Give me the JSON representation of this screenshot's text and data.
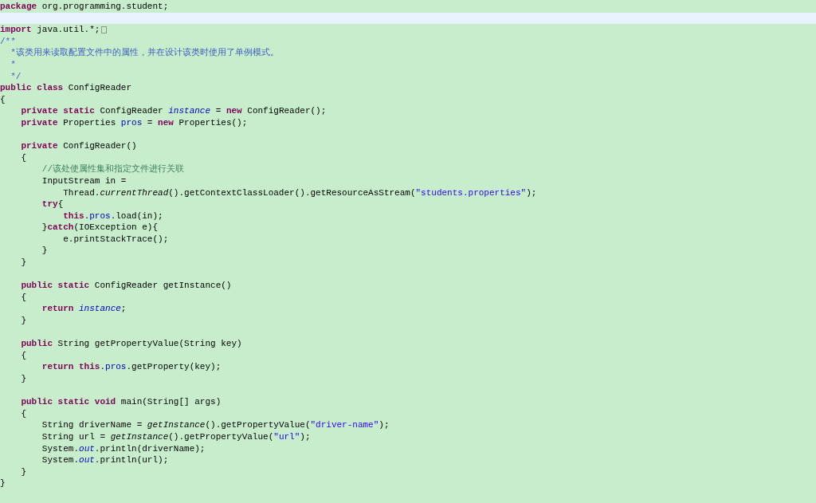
{
  "editor": {
    "lines": [
      {
        "tokens": [
          {
            "text": "package",
            "kind": "keyword"
          },
          {
            "text": " org.programming.student;",
            "kind": "plain"
          }
        ]
      },
      {
        "current": true
      },
      {
        "tokens": [
          {
            "text": "import",
            "kind": "keyword"
          },
          {
            "text": " java.util.*;",
            "kind": "plain"
          }
        ],
        "folded": true
      },
      {
        "tokens": [
          {
            "text": "/**",
            "kind": "javadoc"
          }
        ]
      },
      {
        "tokens": [
          {
            "text": "  *该类用来读取配置文件中的属性，并在设计该类时使用了单例模式。",
            "kind": "javadoc"
          }
        ]
      },
      {
        "tokens": [
          {
            "text": "  *",
            "kind": "javadoc"
          }
        ]
      },
      {
        "tokens": [
          {
            "text": "  */",
            "kind": "javadoc"
          }
        ]
      },
      {
        "tokens": [
          {
            "text": "public class",
            "kind": "keyword"
          },
          {
            "text": " ConfigReader",
            "kind": "plain"
          }
        ]
      },
      {
        "tokens": [
          {
            "text": "{",
            "kind": "plain"
          }
        ]
      },
      {
        "tokens": [
          {
            "text": "    private static",
            "kind": "keyword"
          },
          {
            "text": " ConfigReader ",
            "kind": "plain"
          },
          {
            "text": "instance",
            "kind": "static_field"
          },
          {
            "text": " = ",
            "kind": "plain"
          },
          {
            "text": "new",
            "kind": "keyword"
          },
          {
            "text": " ConfigReader();",
            "kind": "plain"
          }
        ]
      },
      {
        "tokens": [
          {
            "text": "    private",
            "kind": "keyword"
          },
          {
            "text": " Properties ",
            "kind": "plain"
          },
          {
            "text": "pros",
            "kind": "field"
          },
          {
            "text": " = ",
            "kind": "plain"
          },
          {
            "text": "new",
            "kind": "keyword"
          },
          {
            "text": " Properties();",
            "kind": "plain"
          }
        ]
      },
      {
        "current": false
      },
      {
        "tokens": [
          {
            "text": "    private",
            "kind": "keyword"
          },
          {
            "text": " ConfigReader()",
            "kind": "plain"
          }
        ]
      },
      {
        "tokens": [
          {
            "text": "    {",
            "kind": "plain"
          }
        ]
      },
      {
        "tokens": [
          {
            "text": "        //该处使属性集和指定文件进行关联",
            "kind": "comment"
          }
        ]
      },
      {
        "tokens": [
          {
            "text": "        InputStream in =",
            "kind": "plain"
          }
        ]
      },
      {
        "tokens": [
          {
            "text": "            Thread.",
            "kind": "plain"
          },
          {
            "text": "currentThread",
            "kind": "static_method"
          },
          {
            "text": "().getContextClassLoader().getResourceAsStream(",
            "kind": "plain"
          },
          {
            "text": "\"students.properties\"",
            "kind": "string"
          },
          {
            "text": ");",
            "kind": "plain"
          }
        ]
      },
      {
        "tokens": [
          {
            "text": "        try",
            "kind": "keyword"
          },
          {
            "text": "{",
            "kind": "plain"
          }
        ]
      },
      {
        "tokens": [
          {
            "text": "            this",
            "kind": "keyword"
          },
          {
            "text": ".",
            "kind": "plain"
          },
          {
            "text": "pros",
            "kind": "field"
          },
          {
            "text": ".load(in);",
            "kind": "plain"
          }
        ]
      },
      {
        "tokens": [
          {
            "text": "        }",
            "kind": "plain"
          },
          {
            "text": "catch",
            "kind": "keyword"
          },
          {
            "text": "(IOException e){",
            "kind": "plain"
          }
        ]
      },
      {
        "tokens": [
          {
            "text": "            e.printStackTrace();",
            "kind": "plain"
          }
        ]
      },
      {
        "tokens": [
          {
            "text": "        }",
            "kind": "plain"
          }
        ]
      },
      {
        "tokens": [
          {
            "text": "    }",
            "kind": "plain"
          }
        ]
      },
      {
        "current": false
      },
      {
        "tokens": [
          {
            "text": "    public static",
            "kind": "keyword"
          },
          {
            "text": " ConfigReader getInstance()",
            "kind": "plain"
          }
        ]
      },
      {
        "tokens": [
          {
            "text": "    {",
            "kind": "plain"
          }
        ]
      },
      {
        "tokens": [
          {
            "text": "        return",
            "kind": "keyword"
          },
          {
            "text": " instance",
            "kind": "static_field"
          },
          {
            "text": ";",
            "kind": "plain"
          }
        ]
      },
      {
        "tokens": [
          {
            "text": "    }",
            "kind": "plain"
          }
        ]
      },
      {
        "current": false
      },
      {
        "tokens": [
          {
            "text": "    public",
            "kind": "keyword"
          },
          {
            "text": " String getPropertyValue(String key)",
            "kind": "plain"
          }
        ]
      },
      {
        "tokens": [
          {
            "text": "    {",
            "kind": "plain"
          }
        ]
      },
      {
        "tokens": [
          {
            "text": "        return this",
            "kind": "keyword"
          },
          {
            "text": ".",
            "kind": "plain"
          },
          {
            "text": "pros",
            "kind": "field"
          },
          {
            "text": ".getProperty(key);",
            "kind": "plain"
          }
        ]
      },
      {
        "tokens": [
          {
            "text": "    }",
            "kind": "plain"
          }
        ]
      },
      {
        "current": false
      },
      {
        "tokens": [
          {
            "text": "    public static void",
            "kind": "keyword"
          },
          {
            "text": " main(String[] args)",
            "kind": "plain"
          }
        ]
      },
      {
        "tokens": [
          {
            "text": "    {",
            "kind": "plain"
          }
        ]
      },
      {
        "tokens": [
          {
            "text": "        String driverName = ",
            "kind": "plain"
          },
          {
            "text": "getInstance",
            "kind": "static_method"
          },
          {
            "text": "().getPropertyValue(",
            "kind": "plain"
          },
          {
            "text": "\"driver-name\"",
            "kind": "string"
          },
          {
            "text": ");",
            "kind": "plain"
          }
        ]
      },
      {
        "tokens": [
          {
            "text": "        String url = ",
            "kind": "plain"
          },
          {
            "text": "getInstance",
            "kind": "static_method"
          },
          {
            "text": "().getPropertyValue(",
            "kind": "plain"
          },
          {
            "text": "\"url\"",
            "kind": "string"
          },
          {
            "text": ");",
            "kind": "plain"
          }
        ]
      },
      {
        "tokens": [
          {
            "text": "        System.",
            "kind": "plain"
          },
          {
            "text": "out",
            "kind": "static_field"
          },
          {
            "text": ".println(driverName);",
            "kind": "plain"
          }
        ]
      },
      {
        "tokens": [
          {
            "text": "        System.",
            "kind": "plain"
          },
          {
            "text": "out",
            "kind": "static_field"
          },
          {
            "text": ".println(url);",
            "kind": "plain"
          }
        ]
      },
      {
        "tokens": [
          {
            "text": "    }",
            "kind": "plain"
          }
        ]
      },
      {
        "tokens": [
          {
            "text": "}",
            "kind": "plain"
          }
        ]
      }
    ]
  }
}
